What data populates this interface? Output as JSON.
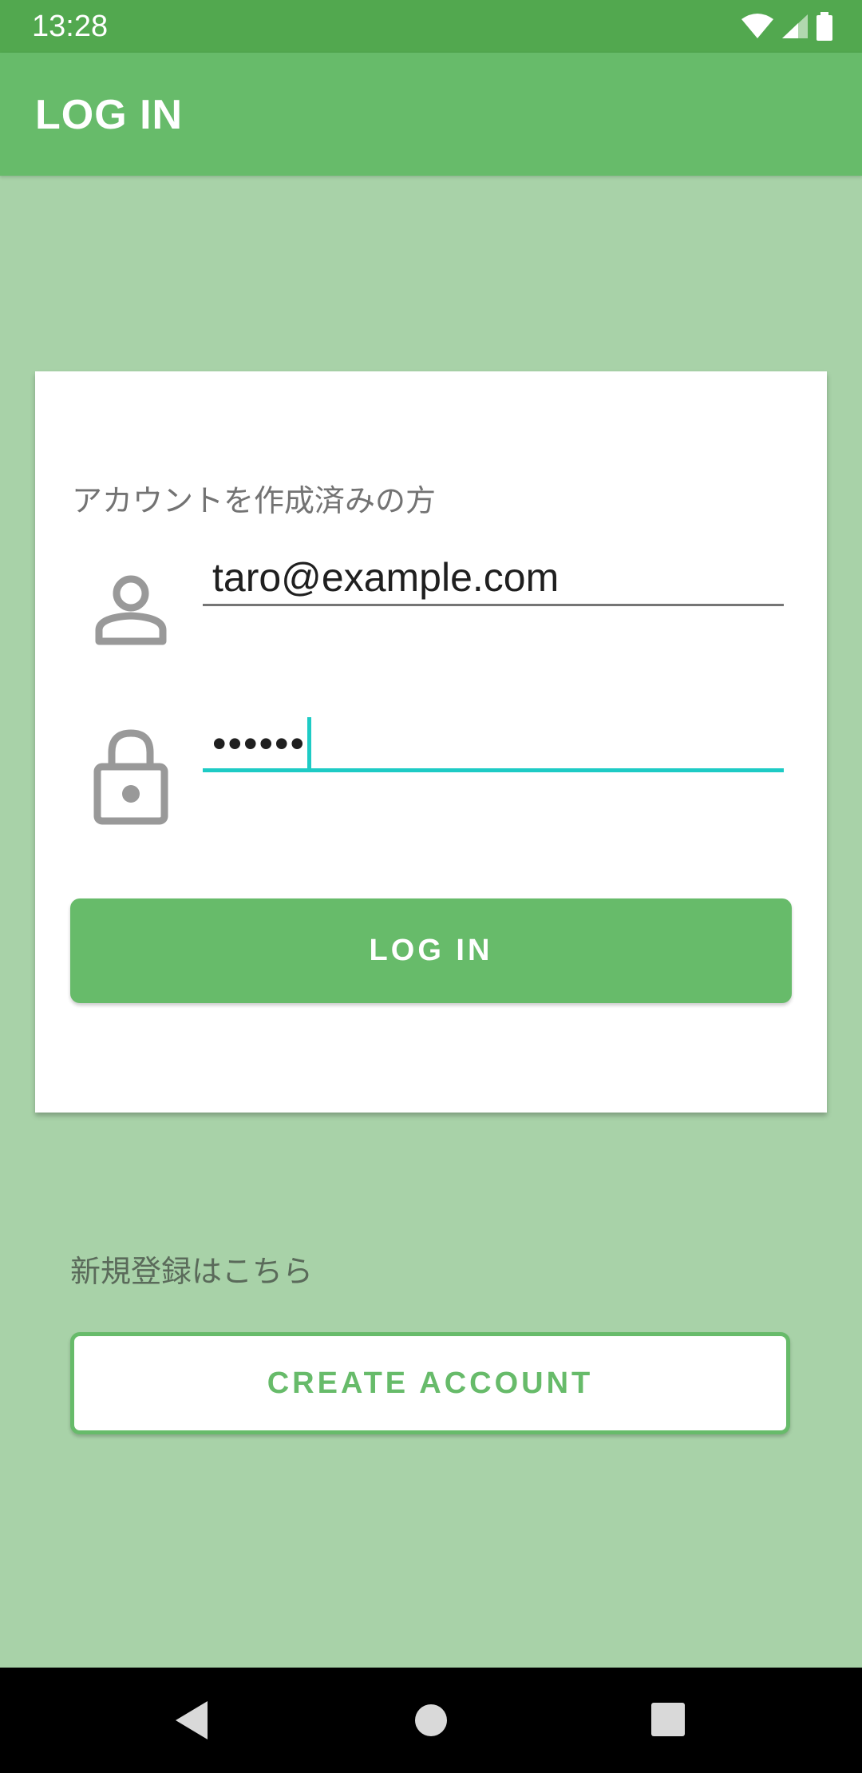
{
  "status_bar": {
    "time": "13:28",
    "icons": [
      "wifi-icon",
      "signal-icon",
      "battery-icon"
    ]
  },
  "app_bar": {
    "title": "LOG IN"
  },
  "login_card": {
    "caption": "アカウントを作成済みの方",
    "email": {
      "icon": "person-icon",
      "value": "taro@example.com"
    },
    "password": {
      "icon": "lock-icon",
      "masked_value": "••••••"
    },
    "login_button_label": "LOG IN"
  },
  "signup": {
    "caption": "新規登録はこちら",
    "create_account_label": "CREATE ACCOUNT"
  },
  "nav_bar": {
    "buttons": [
      "back-icon",
      "home-icon",
      "recents-icon"
    ]
  },
  "colors": {
    "status_bar": "#52a84f",
    "app_bar": "#67bb6a",
    "background": "#a8d2a8",
    "accent_focus": "#1ecbc5",
    "primary_button": "#67bb6a"
  }
}
